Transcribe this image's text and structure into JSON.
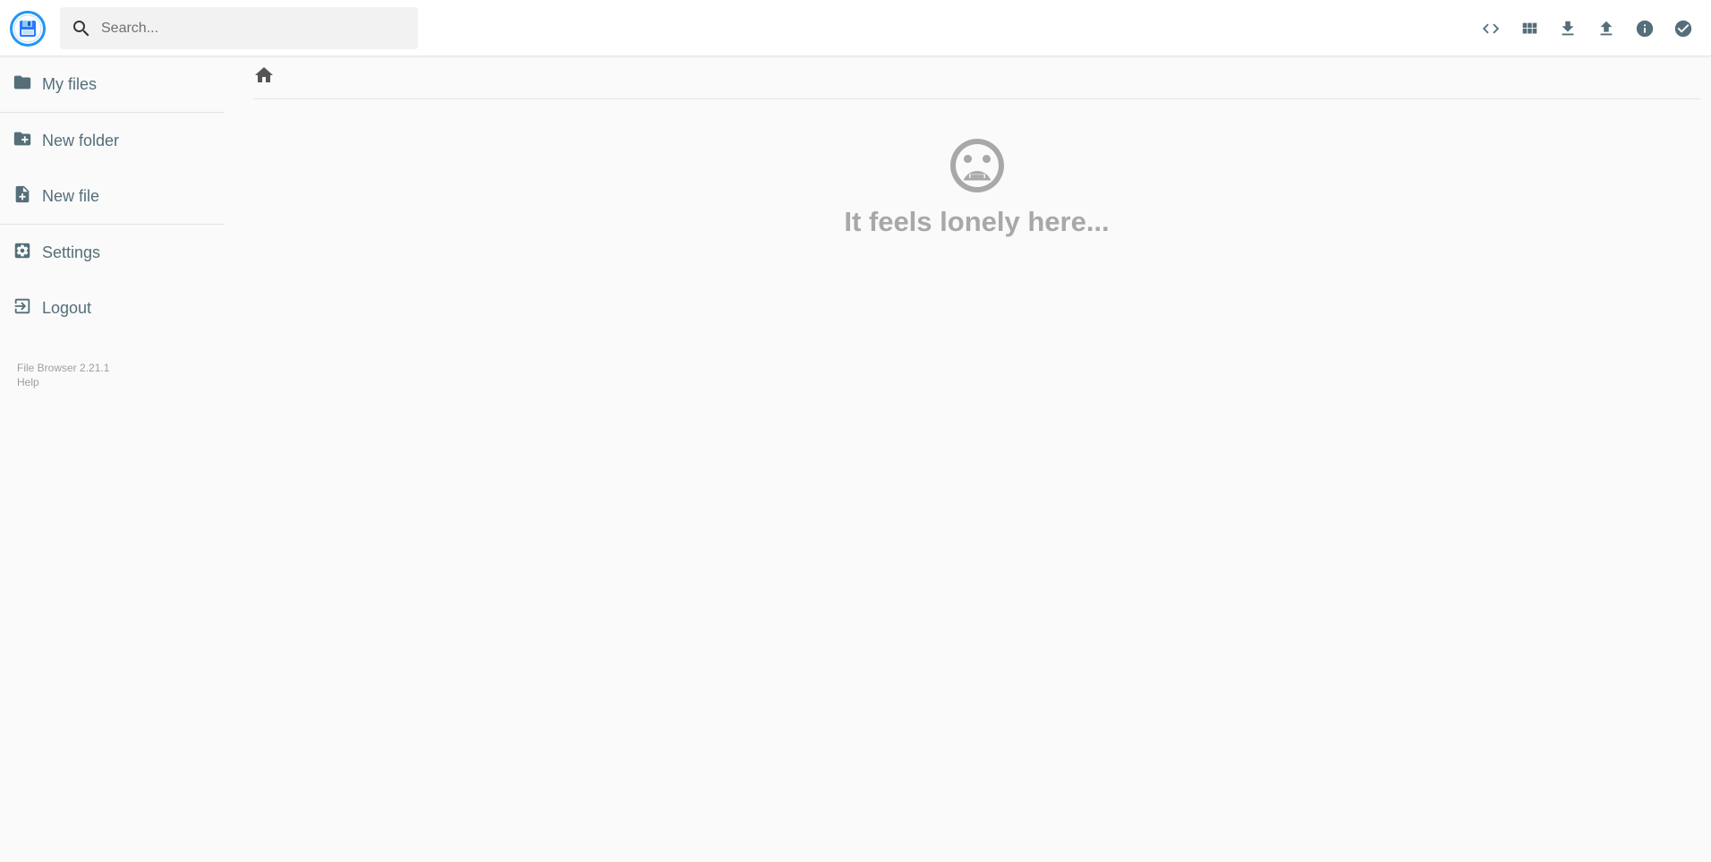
{
  "header": {
    "logo_icon": "floppy-disk-logo",
    "search": {
      "placeholder": "Search...",
      "value": "",
      "icon": "search-icon"
    },
    "actions": [
      {
        "name": "code-icon",
        "label": "Toggle shell"
      },
      {
        "name": "grid-view-icon",
        "label": "Switch view"
      },
      {
        "name": "download-icon",
        "label": "Download"
      },
      {
        "name": "upload-icon",
        "label": "Upload"
      },
      {
        "name": "info-icon",
        "label": "Info"
      },
      {
        "name": "check-circle-icon",
        "label": "Select multiple"
      }
    ]
  },
  "sidebar": {
    "items": [
      {
        "label": "My files",
        "icon": "folder-icon"
      },
      {
        "label": "New folder",
        "icon": "create-new-folder-icon"
      },
      {
        "label": "New file",
        "icon": "note-add-icon"
      },
      {
        "label": "Settings",
        "icon": "settings-icon"
      },
      {
        "label": "Logout",
        "icon": "exit-icon"
      }
    ],
    "credits": {
      "version": "File Browser 2.21.1",
      "help": "Help"
    }
  },
  "main": {
    "breadcrumb_icon": "home-icon",
    "empty": {
      "icon": "sad-face-icon",
      "message": "It feels lonely here..."
    }
  },
  "colors": {
    "accent": "#2196f3",
    "text": "#546e7a",
    "muted": "#a8a8a8",
    "background": "#fafafa"
  }
}
